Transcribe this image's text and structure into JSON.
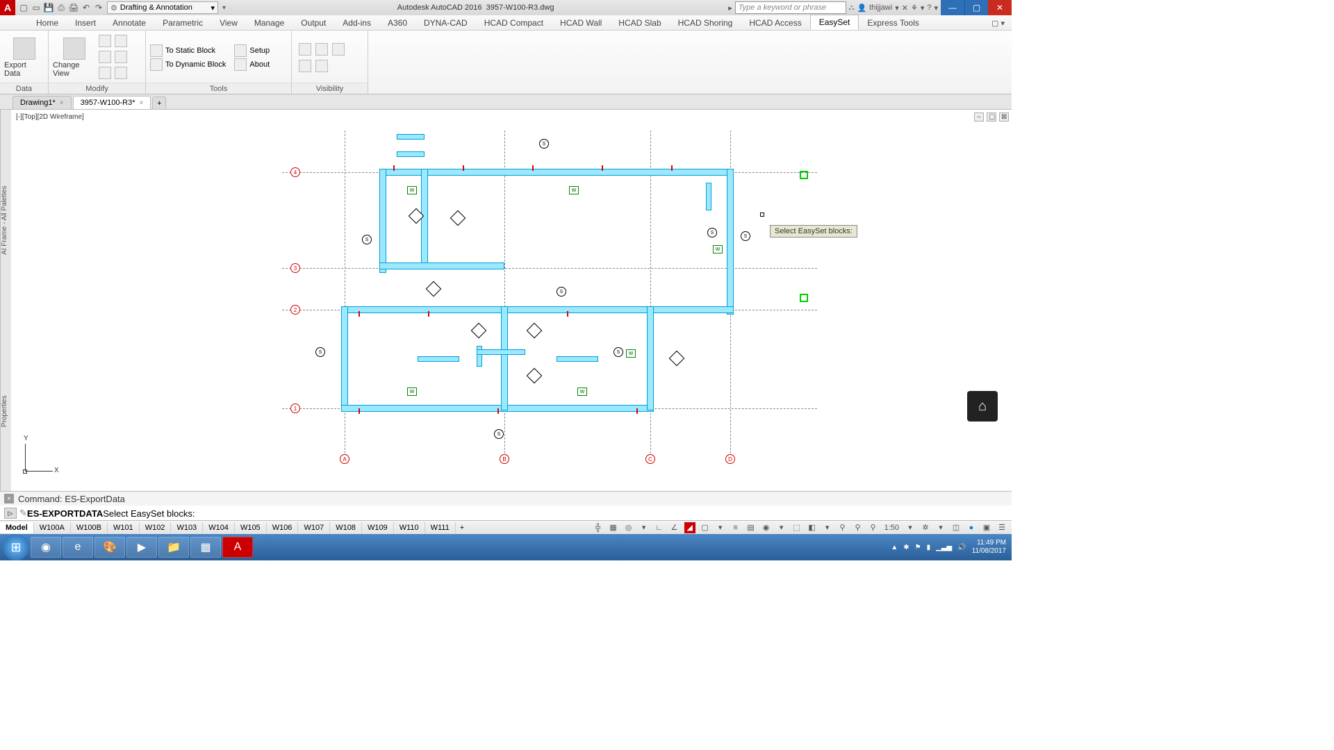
{
  "title": {
    "app": "Autodesk AutoCAD 2016",
    "file": "3957-W100-R3.dwg"
  },
  "workspace": "Drafting & Annotation",
  "search_placeholder": "Type a keyword or phrase",
  "user": "thijjawi",
  "menu_tabs": [
    "Home",
    "Insert",
    "Annotate",
    "Parametric",
    "View",
    "Manage",
    "Output",
    "Add-ins",
    "A360",
    "DYNA-CAD",
    "HCAD Compact",
    "HCAD Wall",
    "HCAD Slab",
    "HCAD Shoring",
    "HCAD Access",
    "EasySet",
    "Express Tools"
  ],
  "active_menu_tab": "EasySet",
  "ribbon": {
    "data": {
      "label": "Data",
      "export": "Export Data"
    },
    "modify": {
      "label": "Modify",
      "change_view": "Change View"
    },
    "tools": {
      "label": "Tools",
      "static": "To Static Block",
      "dynamic": "To Dynamic Block",
      "setup": "Setup",
      "about": "About"
    },
    "visibility": {
      "label": "Visibility"
    }
  },
  "file_tabs": [
    {
      "name": "Drawing1*",
      "active": false
    },
    {
      "name": "3957-W100-R3*",
      "active": true
    }
  ],
  "view_label": "[-][Top][2D Wireframe]",
  "side_palettes": {
    "top": "AI Frame - All Palettes",
    "bottom": "Properties"
  },
  "tooltip": "Select EasySet blocks:",
  "grid": {
    "rows": [
      "4",
      "3",
      "2",
      "1"
    ],
    "cols": [
      "A",
      "B",
      "C",
      "D"
    ]
  },
  "ucs": {
    "x": "X",
    "y": "Y"
  },
  "command": {
    "history": "Command: ES-ExportData",
    "prompt_cmd": "ES-EXPORTDATA",
    "prompt_text": " Select EasySet blocks:"
  },
  "layout_tabs": [
    "Model",
    "W100A",
    "W100B",
    "W101",
    "W102",
    "W103",
    "W104",
    "W105",
    "W106",
    "W107",
    "W108",
    "W109",
    "W110",
    "W111"
  ],
  "active_layout": "Model",
  "status_scale": "1:50",
  "taskbar": {
    "time": "11:49 PM",
    "date": "11/08/2017"
  }
}
